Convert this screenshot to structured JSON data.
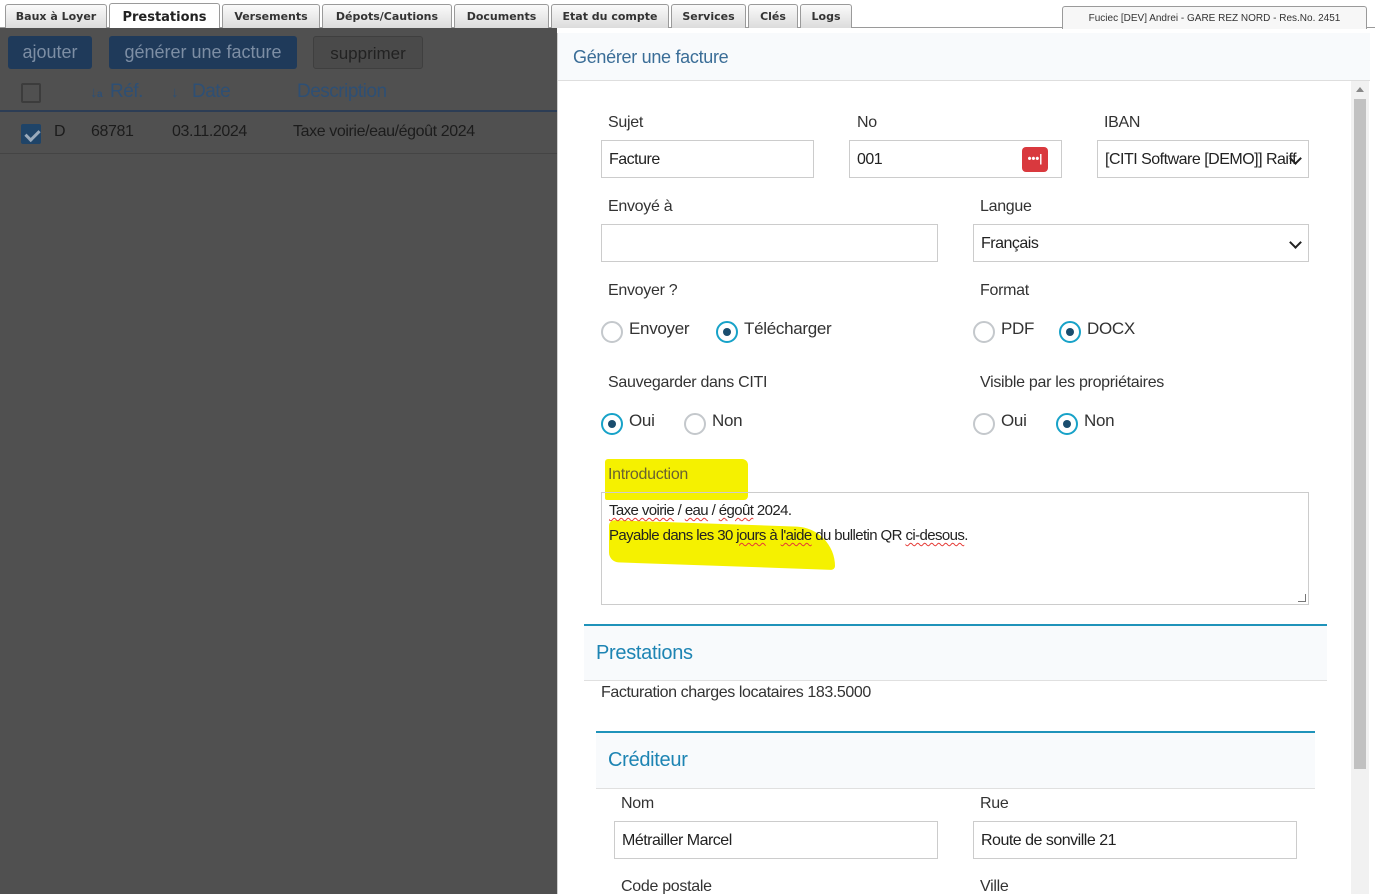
{
  "tabs": [
    {
      "label": "Baux à Loyer",
      "active": false
    },
    {
      "label": "Prestations",
      "active": true
    },
    {
      "label": "Versements",
      "active": false
    },
    {
      "label": "Dépots/Cautions",
      "active": false
    },
    {
      "label": "Documents",
      "active": false
    },
    {
      "label": "Etat du compte",
      "active": false
    },
    {
      "label": "Services",
      "active": false
    },
    {
      "label": "Clés",
      "active": false
    },
    {
      "label": "Logs",
      "active": false
    }
  ],
  "user_info": "Fuciec [DEV] Andrei - GARE REZ NORD - Res.No. 2451",
  "toolbar": {
    "add_label": "ajouter",
    "generate_label": "générer une facture",
    "delete_label": "supprimer"
  },
  "table": {
    "columns": {
      "ref": "Réf.",
      "date": "Date",
      "description": "Description"
    },
    "rows": [
      {
        "checked": true,
        "type": "D",
        "ref": "68781",
        "date": "03.11.2024",
        "description": "Taxe voirie/eau/égoût 2024"
      }
    ]
  },
  "modal": {
    "title": "Générer une facture",
    "subject": {
      "label": "Sujet",
      "value": "Facture"
    },
    "number": {
      "label": "No",
      "value": "001"
    },
    "iban": {
      "label": "IBAN",
      "value": "[CITI Software [DEMO]] Raiff"
    },
    "sent_to": {
      "label": "Envoyé à",
      "value": ""
    },
    "language": {
      "label": "Langue",
      "value": "Français"
    },
    "send": {
      "label": "Envoyer ?",
      "opt1": "Envoyer",
      "opt2": "Télécharger",
      "selected": "Télécharger"
    },
    "format": {
      "label": "Format",
      "opt1": "PDF",
      "opt2": "DOCX",
      "selected": "DOCX"
    },
    "save": {
      "label": "Sauvegarder dans CITI",
      "opt1": "Oui",
      "opt2": "Non",
      "selected": "Oui"
    },
    "visible": {
      "label": "Visible par les propriétaires",
      "opt1": "Oui",
      "opt2": "Non",
      "selected": "Non"
    },
    "introduction": {
      "label": "Introduction",
      "line1": {
        "a": "Taxe voirie",
        "b": " / ",
        "c": "eau",
        "d": " / ",
        "e": "égoût",
        "f": " 2024."
      },
      "line2": {
        "a": "Payable dans les 30 ",
        "b": "jours",
        "c": " à ",
        "d": "l'aide",
        "e": " du bulletin QR ",
        "f": "ci-desous",
        "g": "."
      }
    },
    "prestations": {
      "title": "Prestations",
      "text": "Facturation charges locataires 183.5000"
    },
    "crediteur": {
      "title": "Créditeur",
      "name": {
        "label": "Nom",
        "value": "Métrailler  Marcel"
      },
      "street": {
        "label": "Rue",
        "value": "Route de sonville 21"
      },
      "postal_label": "Code postale",
      "city_label": "Ville"
    }
  },
  "colors": {
    "accent": "#1d84b3",
    "radio_selected": "#17a2c8",
    "highlight": "#f5f100",
    "overlay": "#505050"
  }
}
